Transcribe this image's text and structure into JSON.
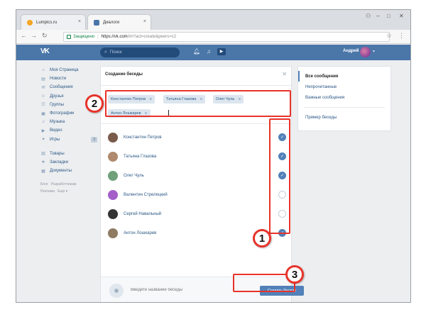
{
  "browser": {
    "tabs": [
      {
        "title": "Lumpics.ru",
        "favicon_color": "#f5a623"
      },
      {
        "title": "Диалоги",
        "favicon_color": "#4a76a8"
      }
    ],
    "address": {
      "secure_label": "Защищено",
      "host": "https://vk.com",
      "path": "/im?act=create&peers=c2"
    }
  },
  "vk": {
    "search_placeholder": "Поиск",
    "username": "Андрей",
    "brand_color": "#4a76a8",
    "accent_color": "#5181b8",
    "leftnav": [
      {
        "label": "Моя Страница",
        "icon": "home-icon",
        "glyph": "⌂"
      },
      {
        "label": "Новости",
        "icon": "news-icon",
        "glyph": "▤"
      },
      {
        "label": "Сообщения",
        "icon": "messages-icon",
        "glyph": "✉"
      },
      {
        "label": "Друзья",
        "icon": "friends-icon",
        "glyph": "☺"
      },
      {
        "label": "Группы",
        "icon": "groups-icon",
        "glyph": "☷"
      },
      {
        "label": "Фотографии",
        "icon": "photos-icon",
        "glyph": "▣"
      },
      {
        "label": "Музыка",
        "icon": "music-icon",
        "glyph": "♫"
      },
      {
        "label": "Видео",
        "icon": "video-icon",
        "glyph": "▶"
      },
      {
        "label": "Игры",
        "icon": "games-icon",
        "glyph": "✦",
        "badge": "3"
      }
    ],
    "leftnav2": [
      {
        "label": "Товары",
        "icon": "goods-icon",
        "glyph": "▥"
      },
      {
        "label": "Закладки",
        "icon": "bookmarks-icon",
        "glyph": "★"
      },
      {
        "label": "Документы",
        "icon": "documents-icon",
        "glyph": "▦"
      }
    ],
    "footer": [
      "Блог",
      "Разработчикам",
      "Реклама",
      "Ещё ▾"
    ]
  },
  "modal": {
    "title": "Создание беседы",
    "tokens": [
      "Константин Петров",
      "Татьяна Глазова",
      "Олег Чуль",
      "Антон Лошкарев"
    ],
    "members": [
      {
        "name": "Константин Петров",
        "selected": true,
        "avatar_color": "#7a5a4a"
      },
      {
        "name": "Татьяна Глазова",
        "selected": true,
        "avatar_color": "#b08a6e"
      },
      {
        "name": "Олег Чуль",
        "selected": true,
        "avatar_color": "#6fa07a"
      },
      {
        "name": "Валентин Стрелецкий",
        "selected": false,
        "avatar_color": "#a45fc9"
      },
      {
        "name": "Сергей Навальный",
        "selected": false,
        "avatar_color": "#333333"
      },
      {
        "name": "Антон Лошкарев",
        "selected": true,
        "avatar_color": "#8f7a62"
      }
    ],
    "name_placeholder": "Введите название беседы",
    "create_label": "Создать беседу"
  },
  "rightpanel": {
    "items": [
      "Все сообщения",
      "Непрочитанные",
      "Важные сообщения"
    ],
    "extra": "Пример беседы"
  },
  "markers": [
    "1",
    "2",
    "3"
  ],
  "highlight_color": "#e8332a"
}
